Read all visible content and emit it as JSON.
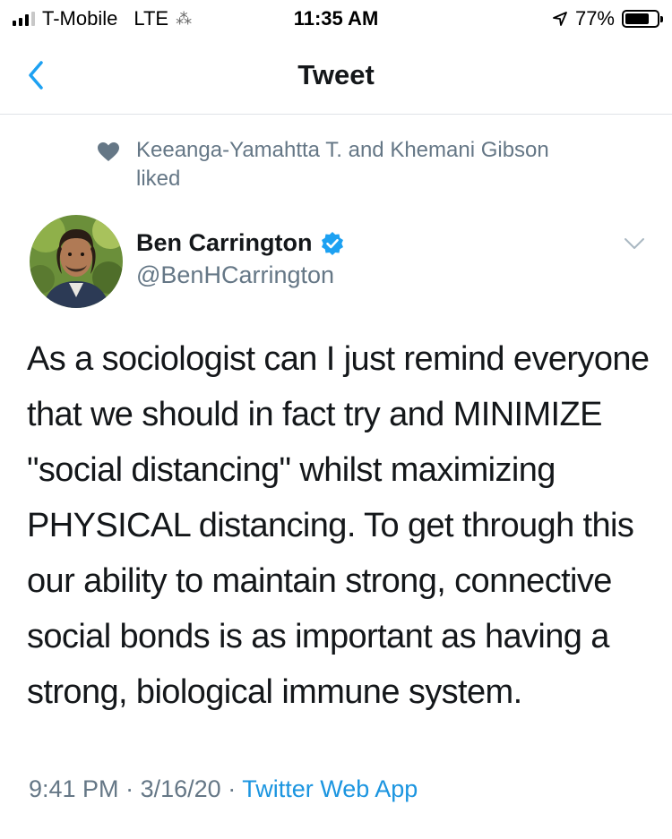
{
  "status_bar": {
    "carrier": "T-Mobile",
    "network": "LTE",
    "time": "11:35 AM",
    "battery_percent": "77%",
    "battery_level": 0.77,
    "signal_bars": 3,
    "signal_total": 4
  },
  "nav": {
    "title": "Tweet",
    "back_icon": "chevron-left-icon"
  },
  "social_context": {
    "icon": "heart-icon",
    "text": "Keeanga-Yamahtta T. and Khemani Gibson liked"
  },
  "author": {
    "name": "Ben Carrington",
    "handle": "@BenHCarrington",
    "verified": true
  },
  "tweet": {
    "text": "As a sociologist can I just remind everyone that we should in fact try and MINIMIZE \"social distancing\" whilst maximizing PHYSICAL distancing. To get through this our ability to maintain strong, connective social bonds is as important as having a strong, biological immune system."
  },
  "meta": {
    "time": "9:41 PM",
    "separator": "·",
    "date": "3/16/20",
    "source": "Twitter Web App"
  },
  "colors": {
    "accent": "#1da1f2",
    "link": "#1b95e0",
    "secondary_text": "#657786",
    "primary_text": "#14171a"
  }
}
